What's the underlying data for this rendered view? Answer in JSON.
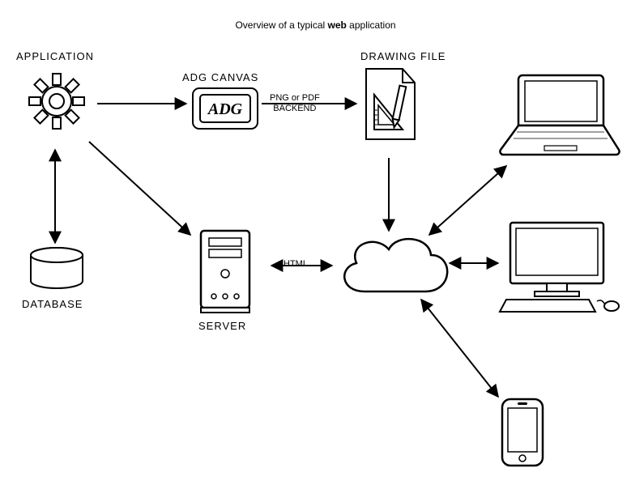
{
  "title_prefix": "Overview of a typical ",
  "title_bold": "web",
  "title_suffix": " application",
  "nodes": {
    "application": {
      "label": "APPLICATION"
    },
    "adg_canvas": {
      "label": "ADG CANVAS",
      "badge": "ADG"
    },
    "drawing_file": {
      "label": "DRAWING FILE"
    },
    "database": {
      "label": "DATABASE"
    },
    "server": {
      "label": "SERVER"
    },
    "cloud": {
      "label": ""
    },
    "laptop": {
      "label": ""
    },
    "desktop": {
      "label": ""
    },
    "phone": {
      "label": ""
    }
  },
  "edges": {
    "canvas_to_file": {
      "line1": "PNG or PDF",
      "line2": "BACKEND"
    },
    "server_to_cloud": {
      "label": "HTML"
    }
  }
}
